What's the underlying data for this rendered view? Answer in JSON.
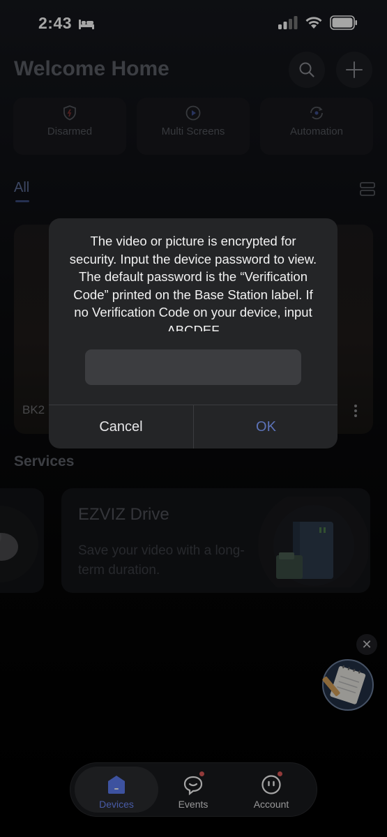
{
  "status_bar": {
    "time": "2:43",
    "icons": [
      "bed-icon",
      "signal-icon",
      "wifi-icon",
      "battery-icon"
    ]
  },
  "header": {
    "title": "Welcome Home",
    "icons": [
      "search-icon",
      "plus-icon"
    ]
  },
  "quick_actions": [
    {
      "label": "Disarmed",
      "icon": "shield-icon"
    },
    {
      "label": "Multi Screens",
      "icon": "play-icon"
    },
    {
      "label": "Automation",
      "icon": "automation-icon"
    }
  ],
  "device_tabs": {
    "active": "All"
  },
  "device_card": {
    "name": "BK2"
  },
  "services": {
    "title": "Services",
    "cards": [
      {
        "title": "EZVIZ Drive",
        "description": "Save your video with a long-term duration."
      }
    ]
  },
  "dialog": {
    "message": "The video or picture is encrypted for security. Input the device password to view. The default password is the “Verification Code” printed on the Base Station label. If no Verification Code on your device, input ABCDEF",
    "input_value": "",
    "cancel_label": "Cancel",
    "ok_label": "OK"
  },
  "tab_bar": {
    "items": [
      {
        "label": "Devices",
        "active": true,
        "badge": false
      },
      {
        "label": "Events",
        "active": false,
        "badge": true
      },
      {
        "label": "Account",
        "active": false,
        "badge": true
      }
    ]
  },
  "colors": {
    "accent": "#6f8cff",
    "ok_text": "#5c73b8",
    "badge": "#e05a5a",
    "dialog_bg": "#242527"
  }
}
